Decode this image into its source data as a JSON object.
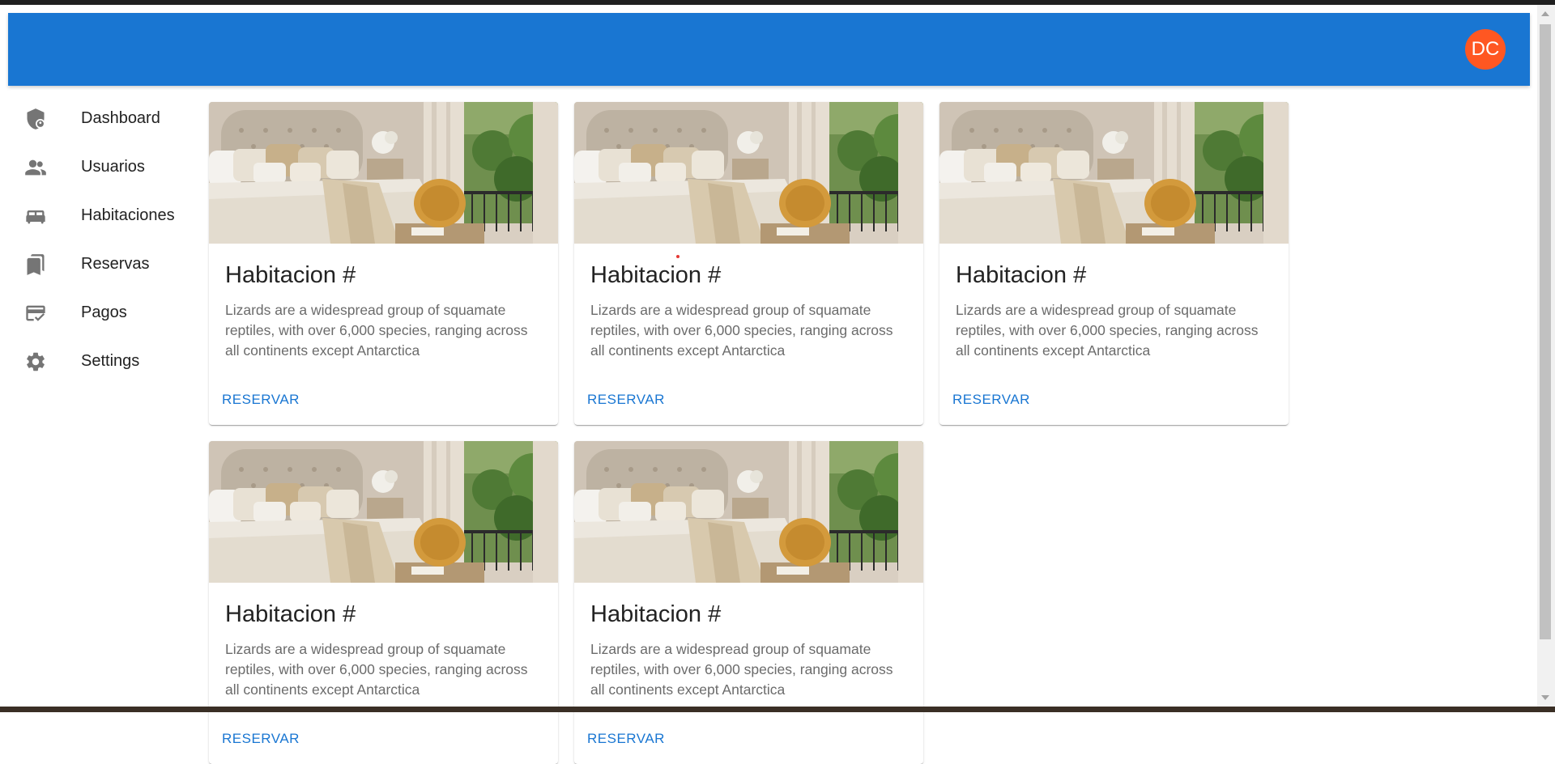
{
  "appbar": {
    "avatar_initials": "DC",
    "color": "#1976d2",
    "avatar_color": "#ff5722"
  },
  "sidebar": {
    "items": [
      {
        "label": "Dashboard",
        "icon": "admin-shield-icon"
      },
      {
        "label": "Usuarios",
        "icon": "people-icon"
      },
      {
        "label": "Habitaciones",
        "icon": "bed-icon"
      },
      {
        "label": "Reservas",
        "icon": "bookmarks-icon"
      },
      {
        "label": "Pagos",
        "icon": "credit-card-check-icon"
      },
      {
        "label": "Settings",
        "icon": "gear-icon"
      }
    ]
  },
  "cards": [
    {
      "title": "Habitacion #",
      "description": "Lizards are a widespread group of squamate reptiles, with over 6,000 species, ranging across all continents except Antarctica",
      "action": "RESERVAR"
    },
    {
      "title": "Habitacion #",
      "description": "Lizards are a widespread group of squamate reptiles, with over 6,000 species, ranging across all continents except Antarctica",
      "action": "RESERVAR"
    },
    {
      "title": "Habitacion #",
      "description": "Lizards are a widespread group of squamate reptiles, with over 6,000 species, ranging across all continents except Antarctica",
      "action": "RESERVAR"
    },
    {
      "title": "Habitacion #",
      "description": "Lizards are a widespread group of squamate reptiles, with over 6,000 species, ranging across all continents except Antarctica",
      "action": "RESERVAR"
    },
    {
      "title": "Habitacion #",
      "description": "Lizards are a widespread group of squamate reptiles, with over 6,000 species, ranging across all continents except Antarctica",
      "action": "RESERVAR"
    }
  ]
}
